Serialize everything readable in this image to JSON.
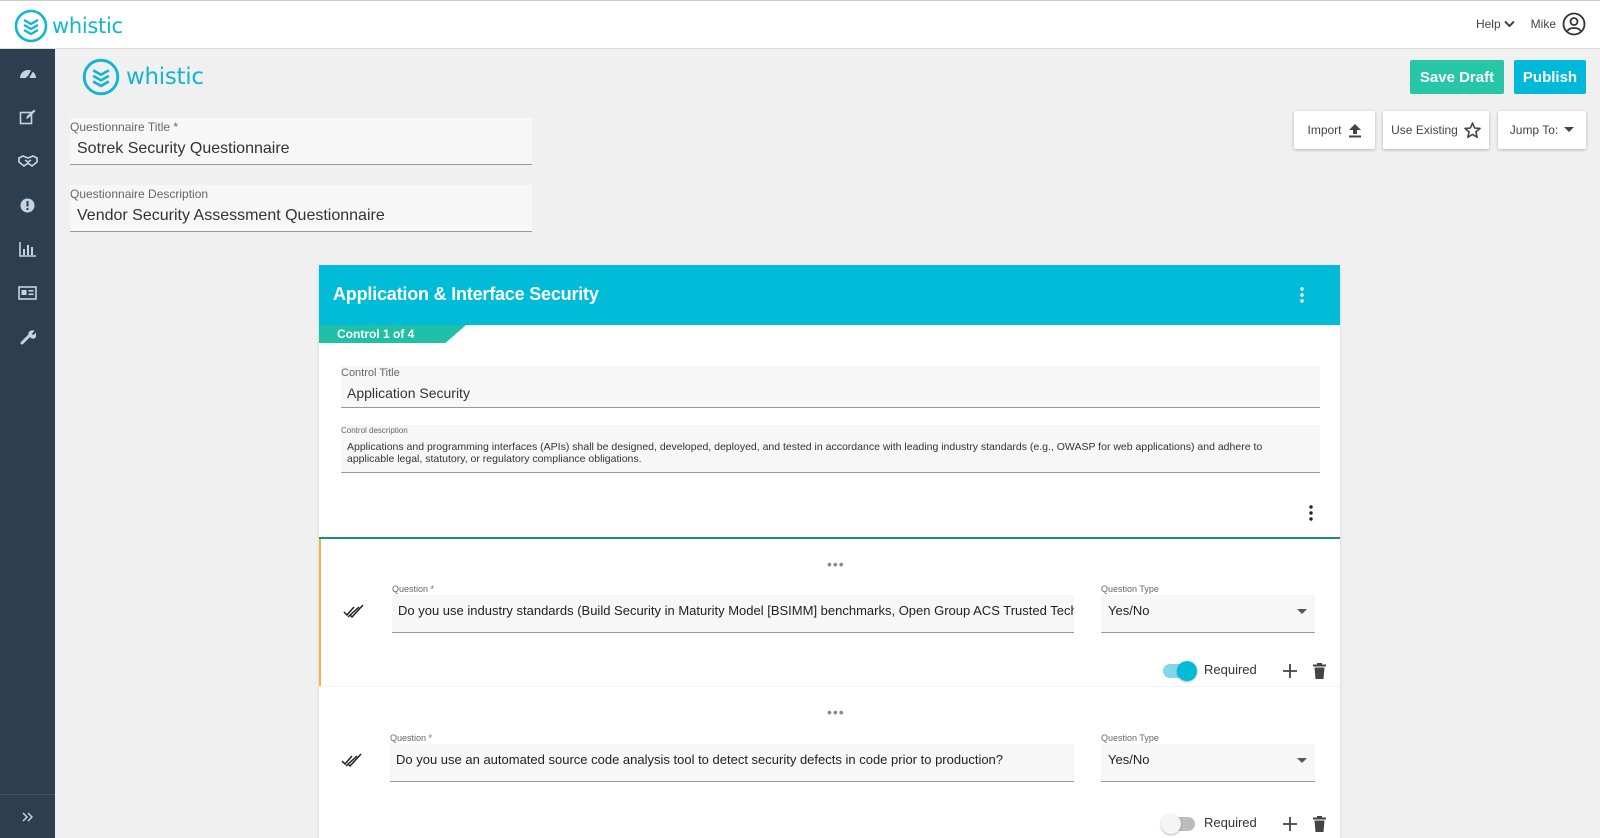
{
  "app": {
    "brand": "whistic",
    "accent": "#13b5d4"
  },
  "topbar": {
    "help_label": "Help",
    "user_name": "Mike"
  },
  "sidebar": {
    "items": [
      {
        "name": "dashboard"
      },
      {
        "name": "edit"
      },
      {
        "name": "handshake"
      },
      {
        "name": "alert"
      },
      {
        "name": "reports"
      },
      {
        "name": "profile-card"
      },
      {
        "name": "tools"
      }
    ],
    "footer_icon": "expand-double-chevron"
  },
  "header": {
    "save_draft": "Save Draft",
    "publish": "Publish",
    "save_color": "#26c6a6",
    "publish_color": "#00b8d9"
  },
  "toolbar": {
    "import": "Import",
    "use_existing": "Use Existing",
    "jump_to": "Jump To:"
  },
  "questionnaire": {
    "title_label": "Questionnaire Title *",
    "title_value": "Sotrek Security Questionnaire",
    "description_label": "Questionnaire Description",
    "description_value": "Vendor Security Assessment Questionnaire"
  },
  "section": {
    "title": "Application & Interface Security",
    "header_color": "#00bcd9",
    "control_tab": "Control 1 of 4",
    "control_title_label": "Control Title",
    "control_title_value": "Application Security",
    "control_desc_label": "Control description",
    "control_desc_value": "Applications and programming interfaces (APIs) shall be designed, developed, deployed, and tested in accordance with leading industry standards (e.g., OWASP for web applications) and adhere to applicable legal, statutory, or regulatory compliance obligations."
  },
  "questions": [
    {
      "label": "Question *",
      "value": "Do you use industry standards (Build Security in Maturity Model [BSIMM] benchmarks, Open Group ACS Trusted Technology Provider Framework, NIST, etc.) to build in security for your Systems/Software Development Lifecycle (SDLC)?",
      "type_label": "Question Type",
      "type_value": "Yes/No",
      "required_label": "Required",
      "required": true
    },
    {
      "label": "Question *",
      "value": "Do you use an automated source code analysis tool to detect security defects in code prior to production?",
      "type_label": "Question Type",
      "type_value": "Yes/No",
      "required_label": "Required",
      "required": false
    }
  ]
}
